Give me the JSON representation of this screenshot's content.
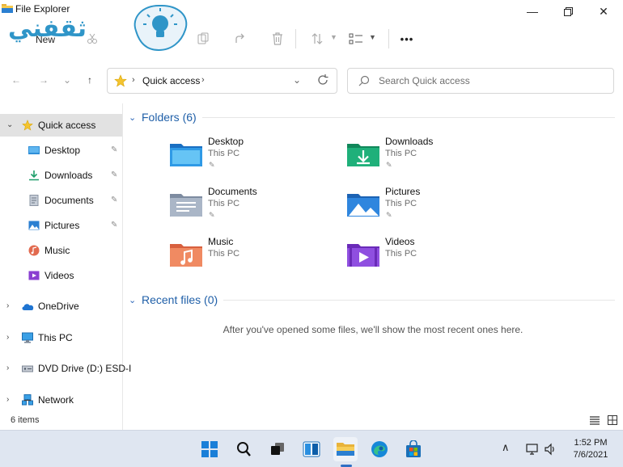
{
  "window": {
    "title": "File Explorer",
    "controls": {
      "minimize": "—",
      "maximize": "☐",
      "close": "✕"
    }
  },
  "watermark": {
    "text": "ثقفني"
  },
  "commandbar": {
    "new_label": "New",
    "items": [
      "cut-icon",
      "copy-icon",
      "paste-icon",
      "share-icon",
      "delete-icon",
      "sort-icon",
      "view-icon",
      "more-icon"
    ],
    "more_label": "•••"
  },
  "navigation": {
    "back": "←",
    "forward": "→",
    "recent": "⌄",
    "up": "↑"
  },
  "address": {
    "location": "Quick access",
    "sep": "›",
    "dropdown": "⌄",
    "refresh": "↻"
  },
  "search": {
    "placeholder": "Search Quick access"
  },
  "sidebar": {
    "items": [
      {
        "label": "Quick access",
        "icon": "star-icon",
        "expand": "⌄"
      },
      {
        "label": "Desktop",
        "icon": "desktop-icon",
        "pin": "📌"
      },
      {
        "label": "Downloads",
        "icon": "download-icon",
        "pin": "📌"
      },
      {
        "label": "Documents",
        "icon": "documents-icon",
        "pin": "📌"
      },
      {
        "label": "Pictures",
        "icon": "pictures-icon",
        "pin": "📌"
      },
      {
        "label": "Music",
        "icon": "music-icon"
      },
      {
        "label": "Videos",
        "icon": "videos-icon"
      },
      {
        "label": "OneDrive",
        "icon": "cloud-icon",
        "expand": "›"
      },
      {
        "label": "This PC",
        "icon": "computer-icon",
        "expand": "›"
      },
      {
        "label": "DVD Drive (D:) ESD-I",
        "icon": "dvd-drive-icon",
        "expand": "›"
      },
      {
        "label": "Network",
        "icon": "network-icon",
        "expand": "›"
      }
    ]
  },
  "folders_group": {
    "title": "Folders (6)",
    "chevron": "⌄",
    "items": [
      {
        "name": "Desktop",
        "location": "This PC",
        "icon": "desktop-folder-icon",
        "pinned": true
      },
      {
        "name": "Downloads",
        "location": "This PC",
        "icon": "downloads-folder-icon",
        "pinned": true
      },
      {
        "name": "Documents",
        "location": "This PC",
        "icon": "documents-folder-icon",
        "pinned": true
      },
      {
        "name": "Pictures",
        "location": "This PC",
        "icon": "pictures-folder-icon",
        "pinned": true
      },
      {
        "name": "Music",
        "location": "This PC",
        "icon": "music-folder-icon",
        "pinned": false
      },
      {
        "name": "Videos",
        "location": "This PC",
        "icon": "videos-folder-icon",
        "pinned": false
      }
    ],
    "pin_glyph": "📌"
  },
  "recent_group": {
    "title": "Recent files (0)",
    "chevron": "⌄",
    "empty_message": "After you've opened some files, we'll show the most recent ones here."
  },
  "statusbar": {
    "count": "6 items"
  },
  "taskbar": {
    "apps": [
      "start-icon",
      "search-icon",
      "task-view-icon",
      "widgets-icon",
      "file-explorer-icon",
      "edge-icon",
      "store-icon"
    ],
    "tray_chevron": "∧",
    "time": "1:52 PM",
    "date": "7/6/2021"
  },
  "colors": {
    "accent": "#1f5fa8",
    "taskbar": "#dfe6f1",
    "selected": "#e2e2e2"
  }
}
